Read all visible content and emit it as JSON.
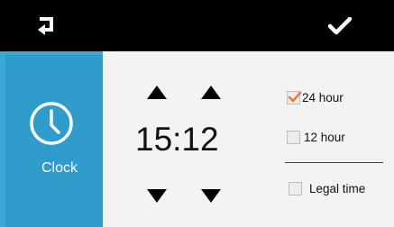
{
  "header": {
    "back_icon": "return-arrow-icon",
    "confirm_icon": "checkmark-icon"
  },
  "sidebar": {
    "active_item": {
      "label": "Clock",
      "icon": "clock-icon"
    },
    "colors": {
      "background": "#3aa9d6",
      "active_tab": "#2f9ccc"
    }
  },
  "time_editor": {
    "time": "15:12",
    "hour_up_icon": "triangle-up-icon",
    "minute_up_icon": "triangle-up-icon",
    "hour_down_icon": "triangle-down-icon",
    "minute_down_icon": "triangle-down-icon"
  },
  "options": {
    "format_24h": {
      "label": "24 hour",
      "checked": true
    },
    "format_12h": {
      "label": "12 hour",
      "checked": false
    },
    "legal_time": {
      "label": "Legal time",
      "checked": false
    },
    "check_color": "#e07b39"
  }
}
